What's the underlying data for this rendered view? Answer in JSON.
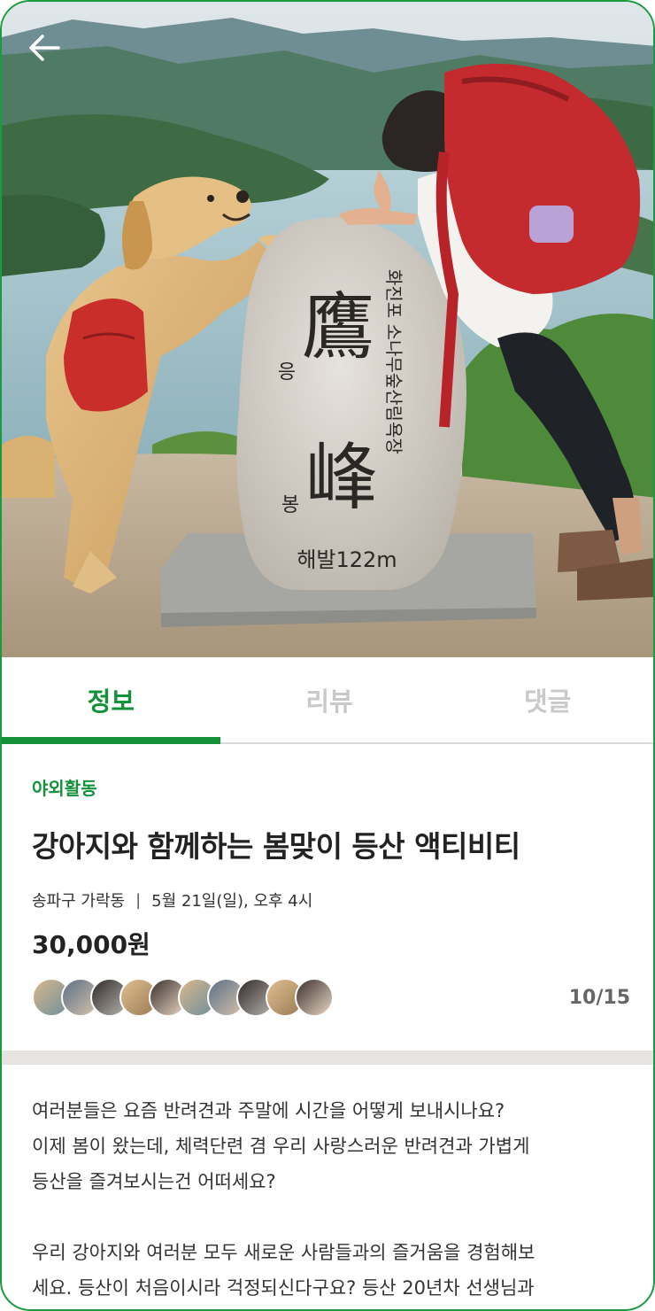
{
  "hero": {
    "stone_big_chars": [
      "鷹",
      "峰"
    ],
    "stone_small_chars": [
      "응",
      "봉"
    ],
    "stone_vertical_text": "화진포 소나무숲산림욕장",
    "stone_altitude": "해발122m"
  },
  "tabs": [
    {
      "label": "정보",
      "active": true
    },
    {
      "label": "리뷰",
      "active": false
    },
    {
      "label": "댓글",
      "active": false
    }
  ],
  "activity": {
    "category": "야외활동",
    "title": "강아지와 함께하는 봄맞이 등산 액티비티",
    "location": "송파구 가락동",
    "datetime": "5월 21일(일), 오후 4시",
    "price": "30,000원",
    "participants": "10/15"
  },
  "description": {
    "para1": [
      "여러분들은 요즘 반려견과 주말에 시간을 어떻게 보내시나요?",
      "이제 봄이 왔는데, 체력단련 겸 우리 사랑스러운 반려견과 가볍게",
      "등산을 즐겨보시는건 어떠세요?"
    ],
    "para2": [
      "우리 강아지와 여러분 모두 새로운 사람들과의 즐거움을 경험해보",
      "세요. 등산이 처음이시라 걱정되신다구요? 등산 20년차 선생님과"
    ]
  },
  "colors": {
    "accent": "#14923a",
    "frame_border": "#1b9a3f",
    "inactive_tab": "#c9c9c9",
    "divider": "#e7e3e1"
  },
  "icons": {
    "back": "arrow-left-icon"
  }
}
